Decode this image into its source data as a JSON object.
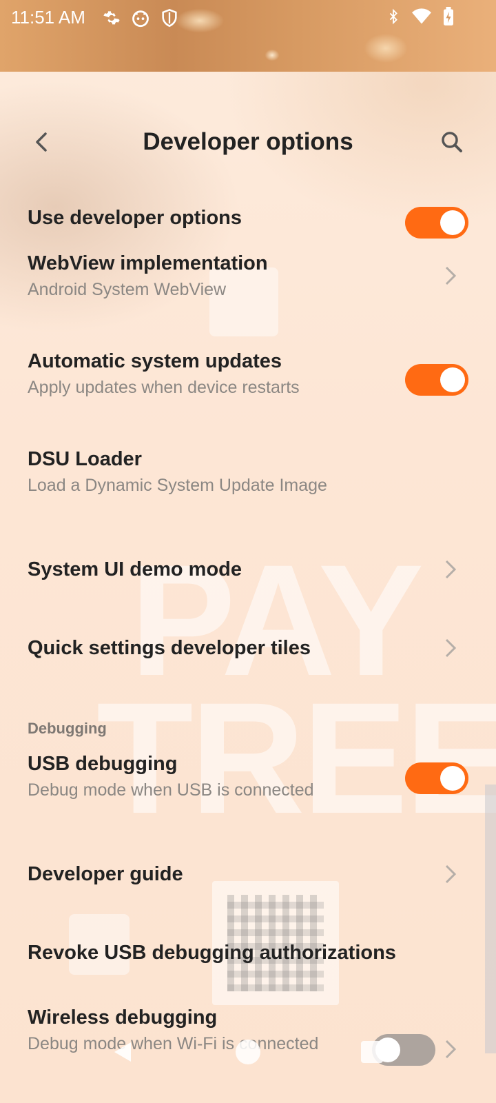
{
  "status_bar": {
    "time": "11:51 AM",
    "left_icons": [
      "gear-icon",
      "android-face-icon",
      "shield-icon"
    ],
    "right_icons": [
      "bluetooth-icon",
      "wifi-icon",
      "battery-icon"
    ]
  },
  "header": {
    "title": "Developer options",
    "back_icon": "back-arrow-icon",
    "search_icon": "search-icon"
  },
  "items": [
    {
      "title": "Use developer options",
      "toggle": true
    },
    {
      "title": "WebView implementation",
      "subtitle": "Android System WebView",
      "chevron": true
    },
    {
      "title": "Automatic system updates",
      "subtitle": "Apply updates when device restarts",
      "toggle": true
    },
    {
      "title": "DSU Loader",
      "subtitle": "Load a Dynamic System Update Image"
    },
    {
      "title": "System UI demo mode",
      "chevron": true
    },
    {
      "title": "Quick settings developer tiles",
      "chevron": true
    }
  ],
  "section": {
    "title": "Debugging"
  },
  "debug_items": [
    {
      "title": "USB debugging",
      "subtitle": "Debug mode when USB is connected",
      "toggle": true
    },
    {
      "title": "Developer guide",
      "chevron": true
    },
    {
      "title": "Revoke USB debugging authorizations"
    },
    {
      "title": "Wireless debugging",
      "subtitle": "Debug mode when Wi-Fi is connected",
      "toggle": false,
      "chevron": true
    }
  ],
  "wallpaper": {
    "line1": "PAY",
    "line2": "TREE"
  },
  "colors": {
    "accent": "#ff6a13",
    "toggle_off": "#ada49e",
    "title_text": "#222222",
    "subtitle_text": "#8b8783"
  }
}
